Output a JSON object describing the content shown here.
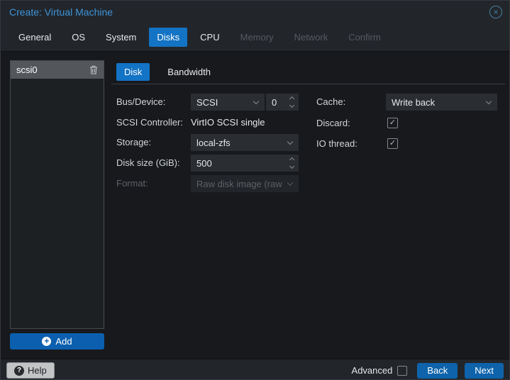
{
  "window": {
    "title": "Create: Virtual Machine"
  },
  "tabs": [
    {
      "label": "General",
      "state": "normal"
    },
    {
      "label": "OS",
      "state": "normal"
    },
    {
      "label": "System",
      "state": "normal"
    },
    {
      "label": "Disks",
      "state": "active"
    },
    {
      "label": "CPU",
      "state": "normal"
    },
    {
      "label": "Memory",
      "state": "disabled"
    },
    {
      "label": "Network",
      "state": "disabled"
    },
    {
      "label": "Confirm",
      "state": "disabled"
    }
  ],
  "sidebar": {
    "items": [
      {
        "label": "scsi0",
        "selected": true
      }
    ],
    "add_label": "Add"
  },
  "subtabs": [
    {
      "label": "Disk",
      "active": true
    },
    {
      "label": "Bandwidth",
      "active": false
    }
  ],
  "form": {
    "left": [
      {
        "label": "Bus/Device:",
        "type": "combo+number",
        "combo_value": "SCSI",
        "number_value": "0"
      },
      {
        "label": "SCSI Controller:",
        "type": "static",
        "value": "VirtIO SCSI single"
      },
      {
        "label": "Storage:",
        "type": "combo",
        "value": "local-zfs"
      },
      {
        "label": "Disk size (GiB):",
        "type": "number",
        "value": "500"
      },
      {
        "label": "Format:",
        "type": "combo",
        "value": "Raw disk image (raw",
        "disabled": true
      }
    ],
    "right": [
      {
        "label": "Cache:",
        "type": "combo",
        "value": "Write back"
      },
      {
        "label": "Discard:",
        "type": "checkbox",
        "checked": true
      },
      {
        "label": "IO thread:",
        "type": "checkbox",
        "checked": true
      }
    ]
  },
  "footer": {
    "help_label": "Help",
    "advanced_label": "Advanced",
    "advanced_checked": false,
    "back_label": "Back",
    "next_label": "Next"
  },
  "icons": {
    "close_glyph": "×",
    "add_glyph": "+",
    "help_glyph": "?",
    "check_glyph": "✓"
  },
  "colors": {
    "accent_blue": "#1373c4",
    "button_blue": "#0b5fae",
    "title_blue": "#3d93d8",
    "panel_dark": "#17191d",
    "bar_dark": "#22262b",
    "selected_item": "#53565b"
  }
}
